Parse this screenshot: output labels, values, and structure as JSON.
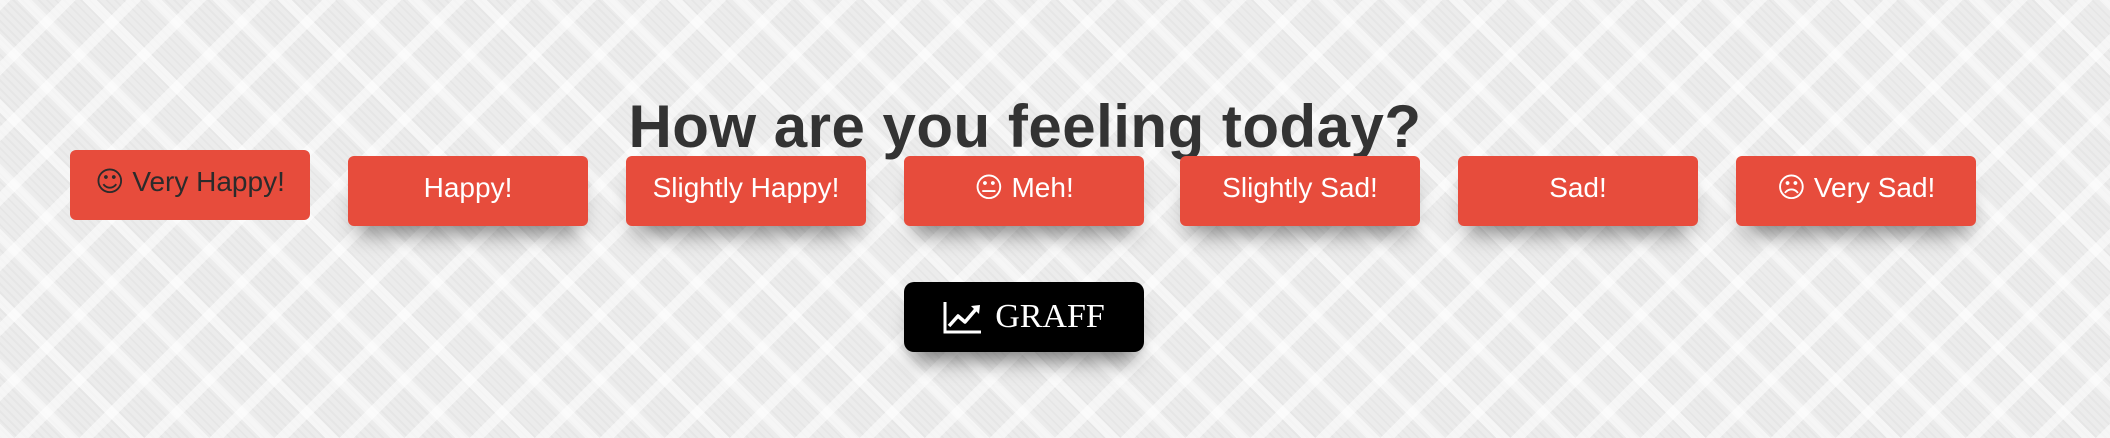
{
  "page": {
    "title": "How are you feeling today?"
  },
  "moods": [
    {
      "label": "Very Happy!",
      "icon": "smile-icon",
      "glyph": "☺"
    },
    {
      "label": "Happy!"
    },
    {
      "label": "Slightly Happy!"
    },
    {
      "label": "Meh!",
      "icon": "neutral-face-icon",
      "glyph": "😐"
    },
    {
      "label": "Slightly Sad!"
    },
    {
      "label": "Sad!"
    },
    {
      "label": "Very Sad!",
      "icon": "frown-icon",
      "glyph": "☹"
    }
  ],
  "graff": {
    "label": "GRAFF",
    "icon": "line-chart-icon"
  },
  "colors": {
    "button": "#e74c3c",
    "button_text": "#ffffff",
    "pressed_text": "#2b2b2b",
    "graff_bg": "#000000",
    "title": "#333333"
  }
}
